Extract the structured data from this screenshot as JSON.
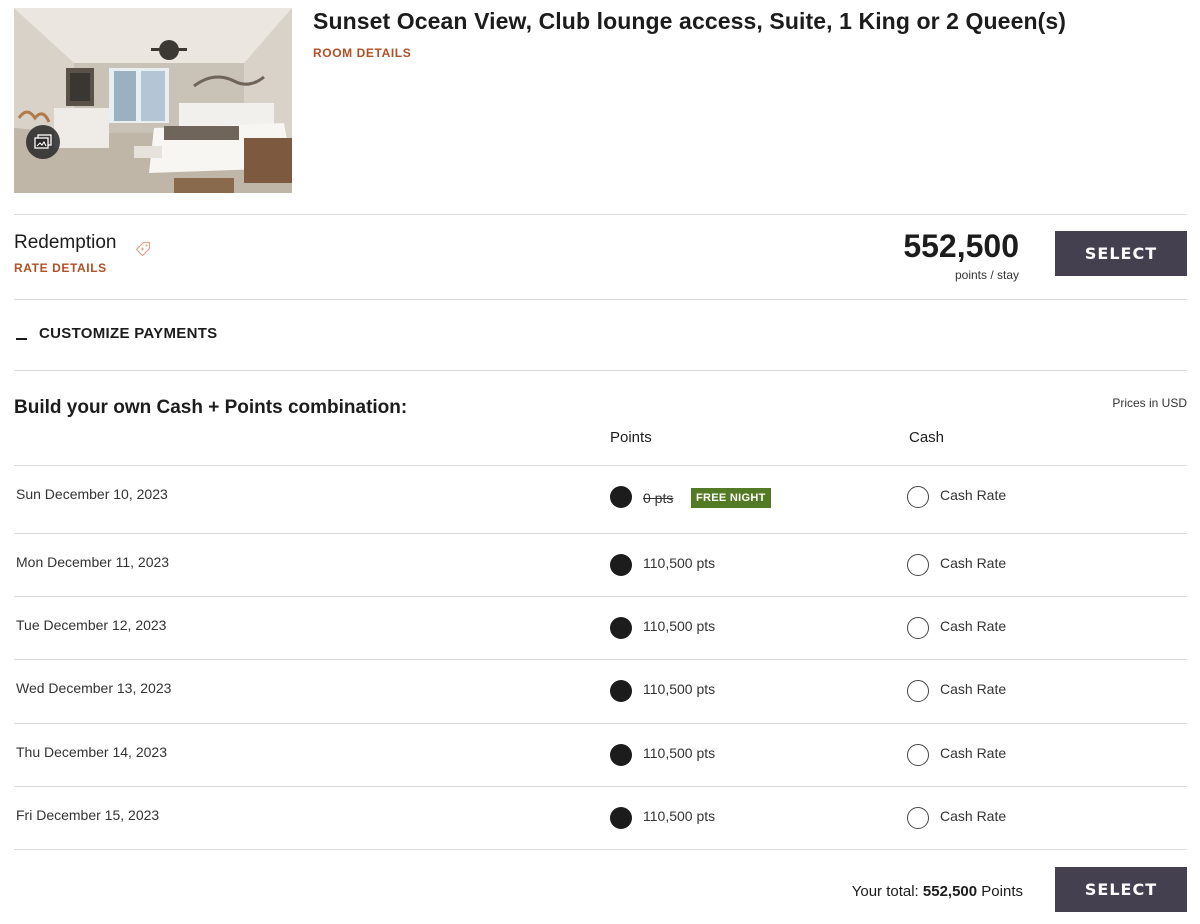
{
  "room": {
    "title": "Sunset Ocean View, Club lounge access, Suite, 1 King or 2 Queen(s)",
    "details_link": "ROOM DETAILS",
    "photo_icon": "gallery-icon"
  },
  "rate": {
    "name": "Redemption",
    "icon": "tag-icon",
    "details_link": "RATE DETAILS",
    "price": "552,500",
    "price_unit": "points / stay",
    "select_label": "SELECT"
  },
  "customize": {
    "label": "CUSTOMIZE PAYMENTS",
    "icon": "minus-icon"
  },
  "combination": {
    "heading": "Build your own Cash + Points combination:",
    "prices_note": "Prices in USD",
    "col_points": "Points",
    "col_cash": "Cash",
    "nights": [
      {
        "date": "Sun December 10, 2023",
        "points": "0 pts",
        "struck": true,
        "badge": "FREE NIGHT",
        "cash": "Cash Rate",
        "selected": "points"
      },
      {
        "date": "Mon December 11, 2023",
        "points": "110,500 pts",
        "struck": false,
        "badge": "",
        "cash": "Cash Rate",
        "selected": "points"
      },
      {
        "date": "Tue December 12, 2023",
        "points": "110,500 pts",
        "struck": false,
        "badge": "",
        "cash": "Cash Rate",
        "selected": "points"
      },
      {
        "date": "Wed December 13, 2023",
        "points": "110,500 pts",
        "struck": false,
        "badge": "",
        "cash": "Cash Rate",
        "selected": "points"
      },
      {
        "date": "Thu December 14, 2023",
        "points": "110,500 pts",
        "struck": false,
        "badge": "",
        "cash": "Cash Rate",
        "selected": "points"
      },
      {
        "date": "Fri December 15, 2023",
        "points": "110,500 pts",
        "struck": false,
        "badge": "",
        "cash": "Cash Rate",
        "selected": "points"
      }
    ]
  },
  "total": {
    "prefix": "Your total:",
    "amount": "552,500",
    "unit": "Points",
    "select_label": "SELECT"
  },
  "colors": {
    "accent_link": "#b14f25",
    "button_bg": "#45404f",
    "badge_bg": "#537a24"
  }
}
